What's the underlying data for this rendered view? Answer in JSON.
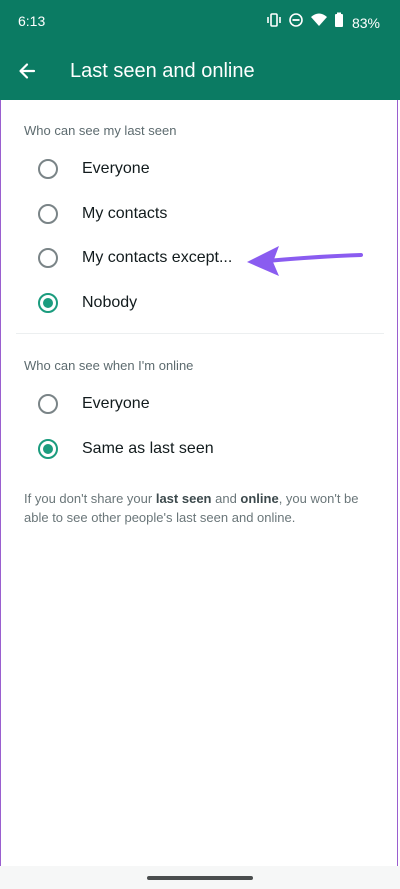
{
  "status_bar": {
    "time": "6:13",
    "battery_percent": "83%",
    "icons": [
      "vibrate-icon",
      "do-not-disturb-icon",
      "wifi-icon",
      "battery-icon"
    ]
  },
  "app_bar": {
    "title": "Last seen and online",
    "back_icon": "arrow-left-icon"
  },
  "last_seen": {
    "header": "Who can see my last seen",
    "options": [
      {
        "label": "Everyone",
        "selected": false
      },
      {
        "label": "My contacts",
        "selected": false
      },
      {
        "label": "My contacts except...",
        "selected": false
      },
      {
        "label": "Nobody",
        "selected": true
      }
    ]
  },
  "online": {
    "header": "Who can see when I'm online",
    "options": [
      {
        "label": "Everyone",
        "selected": false
      },
      {
        "label": "Same as last seen",
        "selected": true
      }
    ]
  },
  "footnote": {
    "part1": "If you don't share your ",
    "bold1": "last seen",
    "part2": " and ",
    "bold2": "online",
    "part3": ", you won't be able to see other people's last seen and online."
  },
  "colors": {
    "brand": "#0b7b63",
    "radio_checked": "#1b9c7e",
    "annotation_arrow": "#8a5cf0"
  }
}
